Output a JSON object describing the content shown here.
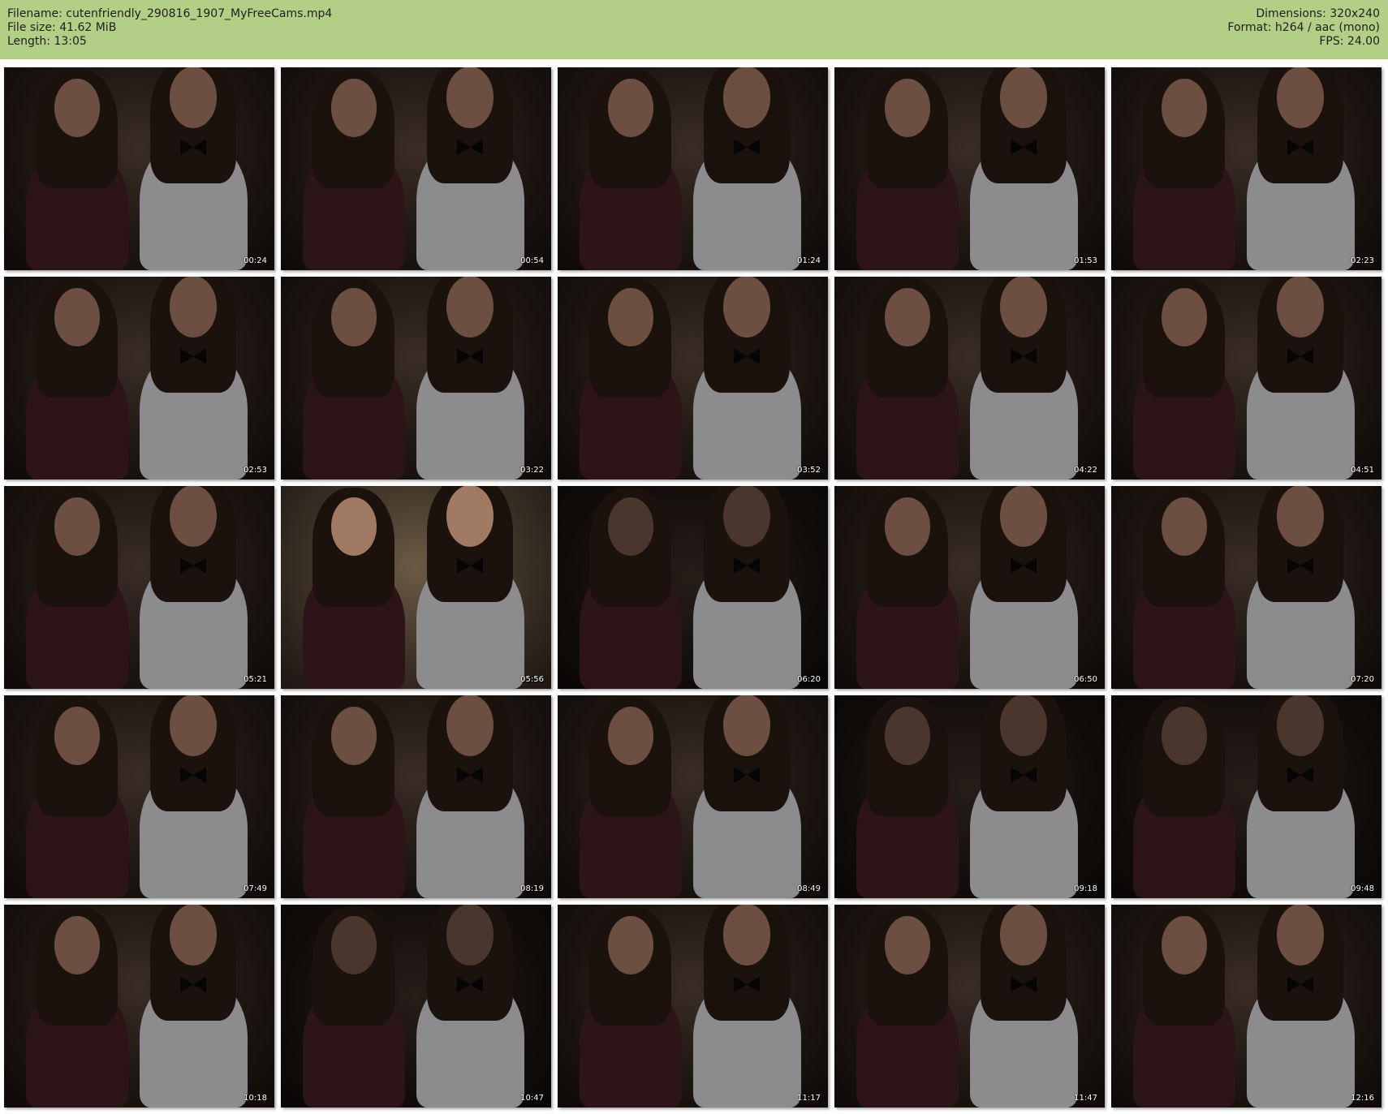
{
  "header": {
    "filename": "Filename: cutenfriendly_290816_1907_MyFreeCams.mp4",
    "file_size": "File size: 41.62 MiB",
    "length": "Length: 13:05",
    "dimensions": "Dimensions: 320x240",
    "format": "Format: h264 / aac (mono)",
    "fps": "FPS: 24.00",
    "background_color": "#b3cf86"
  },
  "thumbnails": [
    {
      "timestamp": "00:24"
    },
    {
      "timestamp": "00:54"
    },
    {
      "timestamp": "01:24"
    },
    {
      "timestamp": "01:53"
    },
    {
      "timestamp": "02:23"
    },
    {
      "timestamp": "02:53"
    },
    {
      "timestamp": "03:22"
    },
    {
      "timestamp": "03:52"
    },
    {
      "timestamp": "04:22"
    },
    {
      "timestamp": "04:51"
    },
    {
      "timestamp": "05:21"
    },
    {
      "timestamp": "05:56"
    },
    {
      "timestamp": "06:20"
    },
    {
      "timestamp": "06:50"
    },
    {
      "timestamp": "07:20"
    },
    {
      "timestamp": "07:49"
    },
    {
      "timestamp": "08:19"
    },
    {
      "timestamp": "08:49"
    },
    {
      "timestamp": "09:18"
    },
    {
      "timestamp": "09:48"
    },
    {
      "timestamp": "10:18"
    },
    {
      "timestamp": "10:47"
    },
    {
      "timestamp": "11:17"
    },
    {
      "timestamp": "11:47"
    },
    {
      "timestamp": "12:16"
    }
  ]
}
